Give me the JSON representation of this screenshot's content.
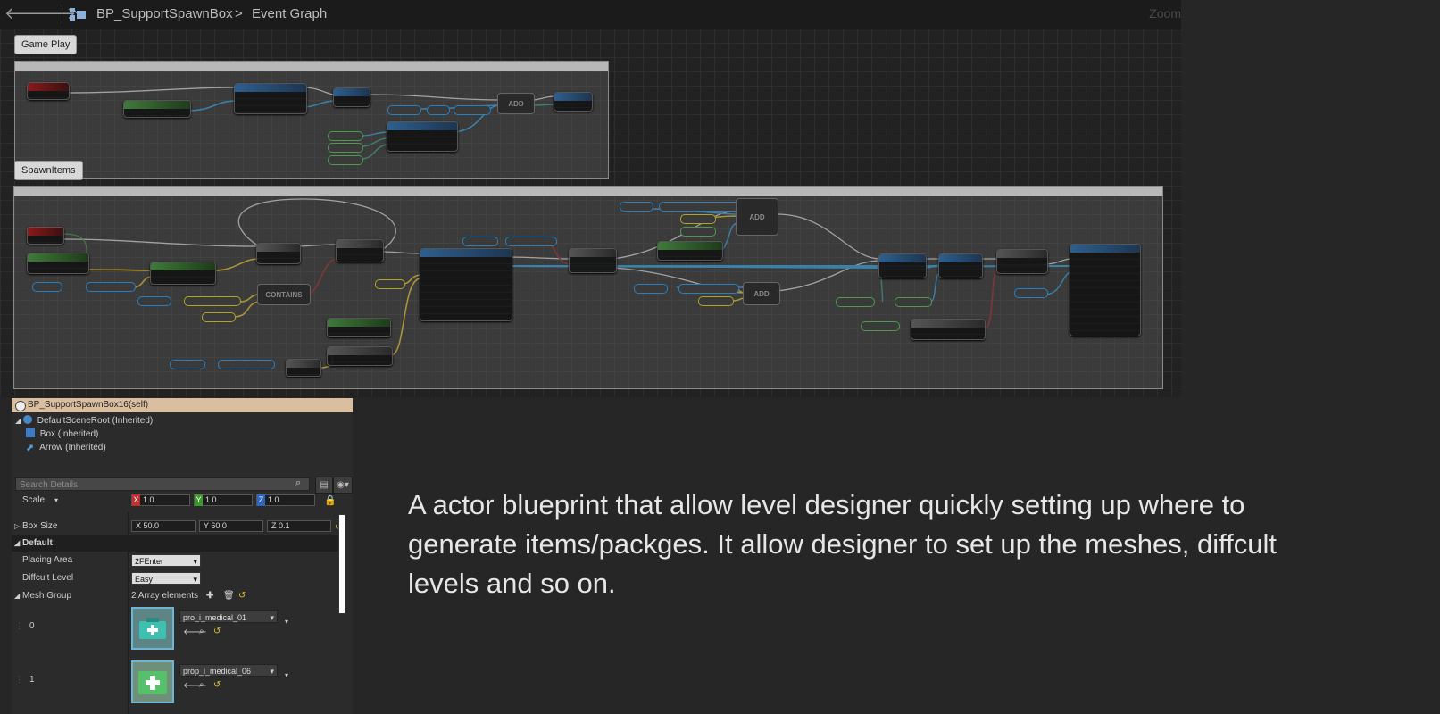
{
  "toolbar": {
    "back_icon": "back-arrow-icon",
    "forward_icon": "forward-arrow-icon",
    "blueprint_name": "BP_SupportSpawnBox",
    "separator": ">",
    "graph_name": "Event Graph",
    "zoom_label": "Zoom"
  },
  "graph": {
    "comment_gameplay": "Game Play",
    "comment_spawnitems": "SpawnItems",
    "node_labels": {
      "contains": "CONTAINS",
      "add_1": "ADD",
      "add_2": "ADD",
      "add_3": "ADD"
    }
  },
  "components": {
    "root": "BP_SupportSpawnBox16(self)",
    "scene_root": "DefaultSceneRoot (Inherited)",
    "box": "Box (Inherited)",
    "arrow": "Arrow (Inherited)"
  },
  "details": {
    "search_placeholder": "Search Details",
    "scale": {
      "label": "Scale",
      "x": "1.0",
      "y": "1.0",
      "z": "1.0"
    },
    "box_size": {
      "label": "Box Size",
      "x": "50.0",
      "y": "60.0",
      "z": "0.1"
    },
    "category_default": "Default",
    "placing_area": {
      "label": "Placing Area",
      "value": "2FEnter"
    },
    "difficult_level": {
      "label": "Diffcult Level",
      "value": "Easy"
    },
    "mesh_group": {
      "label": "Mesh Group",
      "count_text": "2 Array elements",
      "items": [
        {
          "index": "0",
          "asset": "pro_i_medical_01"
        },
        {
          "index": "1",
          "asset": "prop_i_medical_06"
        }
      ]
    }
  },
  "description": "A actor blueprint that allow level designer quickly setting up where to generate items/packges. It allow designer to set up the meshes, diffcult levels and so on.",
  "colors": {
    "exec_wire": "#e0e0e0",
    "object_wire": "#1fa0e8",
    "vector_wire": "#e8c31f",
    "bool_wire": "#9b1a1a",
    "struct_wire": "#2a9a7a"
  }
}
